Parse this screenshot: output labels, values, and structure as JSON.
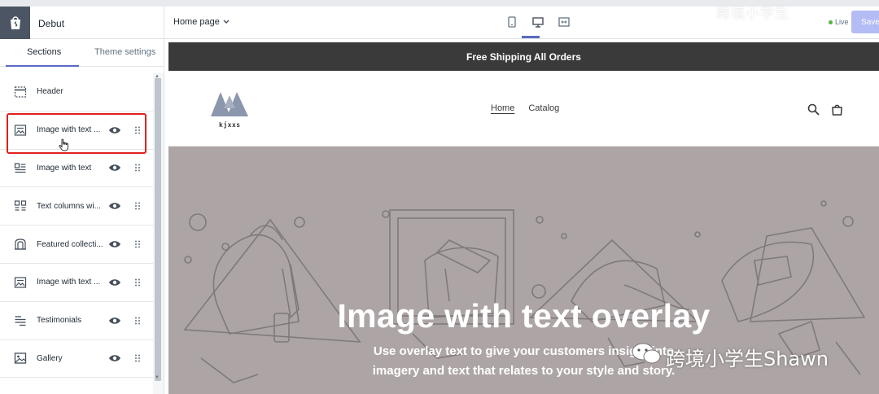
{
  "topbar": {
    "theme_name": "Debut",
    "page_selector": "Home page",
    "status_live": "Live",
    "save_label": "Save",
    "watermark": "跨境小学生"
  },
  "sidebar": {
    "tabs": [
      "Sections",
      "Theme settings"
    ],
    "active_tab": "Sections",
    "items": [
      {
        "label": "Header",
        "icon": "header-layout-icon"
      },
      {
        "label": "Image with text ...",
        "icon": "image-text-icon",
        "selected": true
      },
      {
        "label": "Image with text",
        "icon": "image-text-icon"
      },
      {
        "label": "Text columns wi...",
        "icon": "columns-icon"
      },
      {
        "label": "Featured collecti...",
        "icon": "collection-icon"
      },
      {
        "label": "Image with text ...",
        "icon": "image-text-icon"
      },
      {
        "label": "Testimonials",
        "icon": "testimonials-icon"
      },
      {
        "label": "Gallery",
        "icon": "gallery-icon"
      }
    ]
  },
  "preview": {
    "announcement": "Free Shipping All Orders",
    "store_logo_text": "kjxxs",
    "nav": [
      "Home",
      "Catalog"
    ],
    "hero": {
      "title": "Image with text overlay",
      "sub_line1": "Use overlay text to give your customers insight into",
      "sub_line2": "imagery and text that relates to your style and story.",
      "watermark": "跨境小学生Shawn"
    }
  },
  "colors": {
    "accent": "#5c6ac4",
    "highlight": "#e0201f",
    "announcement_bg": "#3a3a3a",
    "hero_bg": "#ada5a5",
    "live": "#50b83c"
  }
}
